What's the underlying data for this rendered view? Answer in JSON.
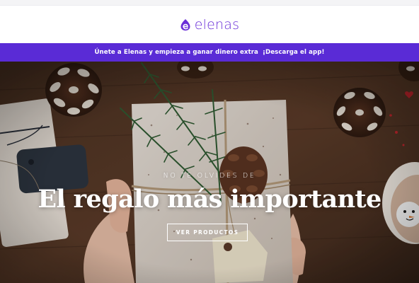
{
  "brand": {
    "name": "elenas",
    "logo_icon": "elenas-drop-logo-icon",
    "color": "#6a2fd8"
  },
  "promo_bar": {
    "text": "Únete a Elenas y empieza a ganar dinero extra",
    "link_label": "¡Descarga el app!",
    "background": "#5a2bd6"
  },
  "hero": {
    "image": "christmas-gift-in-hands-photo",
    "eyebrow": "NO TE OLVIDES DE",
    "title": "El regalo más importante",
    "cta_label": "VER PRODUCTOS"
  }
}
